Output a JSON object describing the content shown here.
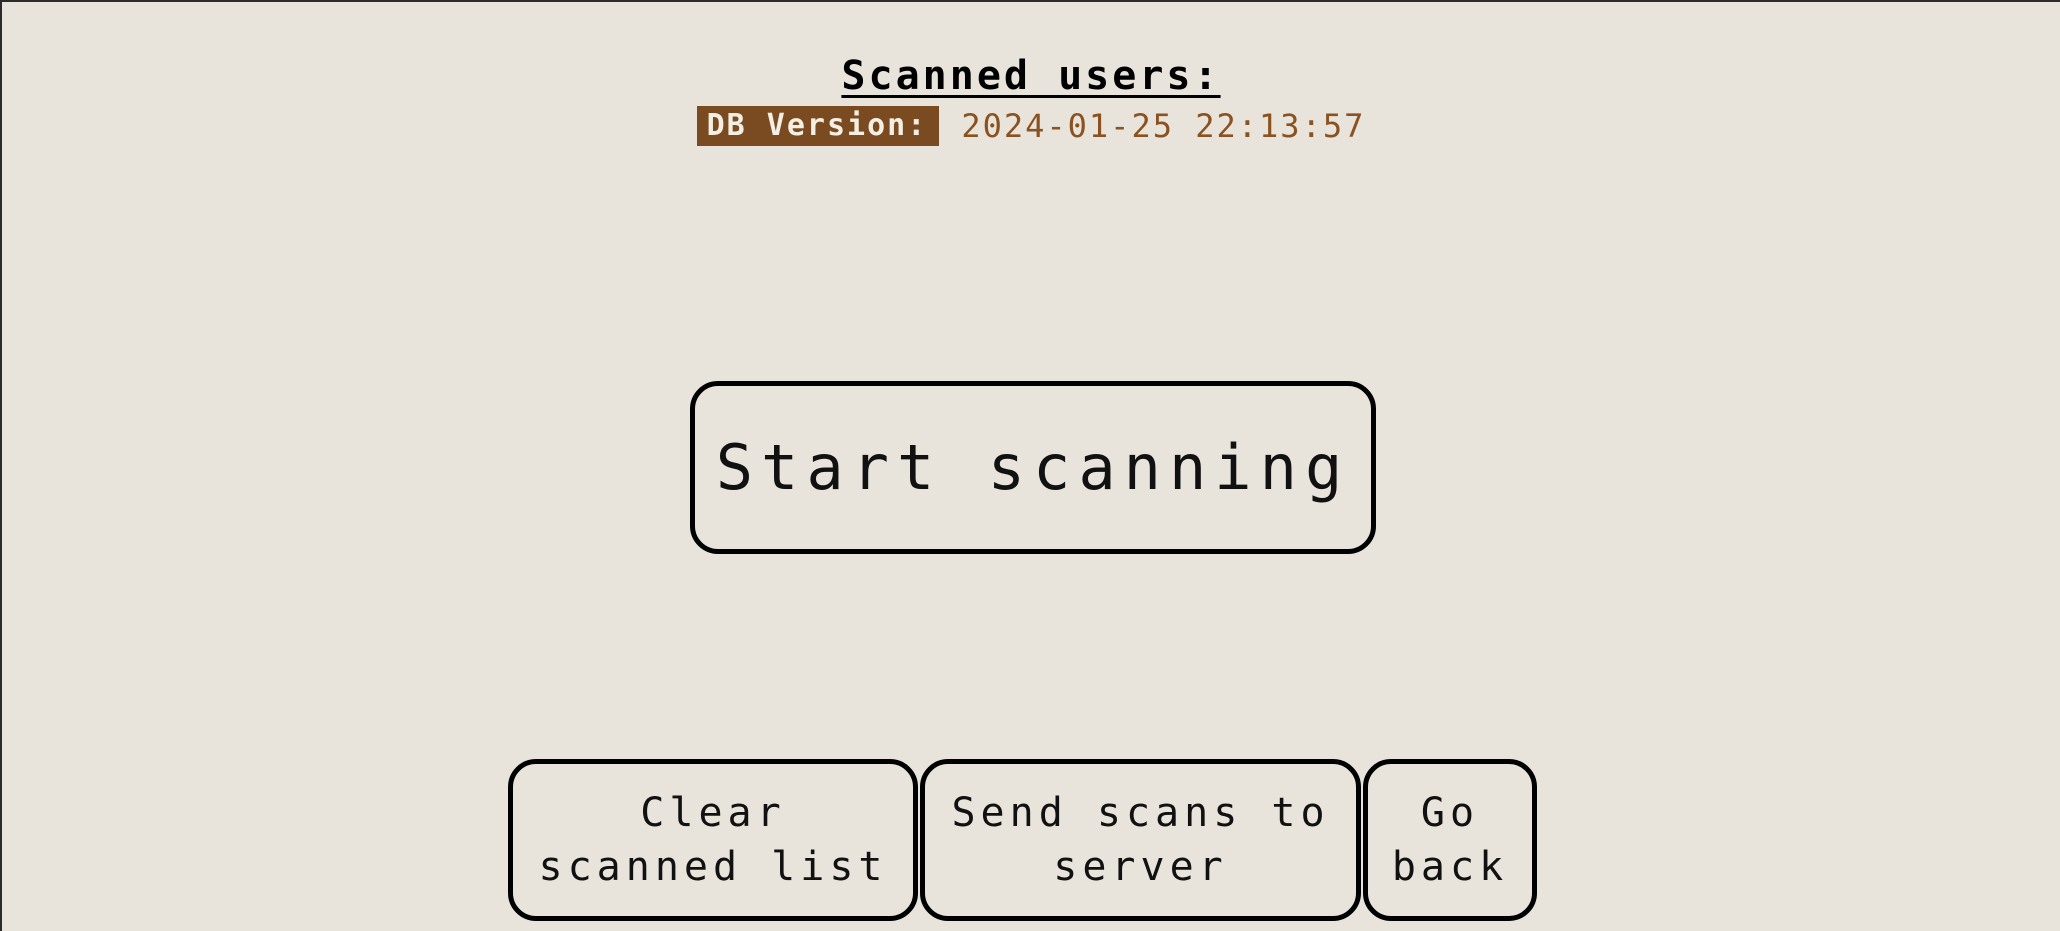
{
  "header": {
    "title": "Scanned users:",
    "db_version_label": "DB Version:",
    "db_version_value": "2024-01-25 22:13:57"
  },
  "main": {
    "start_button_label": "Start scanning"
  },
  "footer": {
    "clear_button_label": "Clear scanned list",
    "send_button_label": "Send scans to server",
    "back_button_label": "Go back"
  },
  "colors": {
    "background": "#e8e4dc",
    "accent_brown": "#7a4a20",
    "version_text": "#8a5220",
    "border": "#000000"
  }
}
